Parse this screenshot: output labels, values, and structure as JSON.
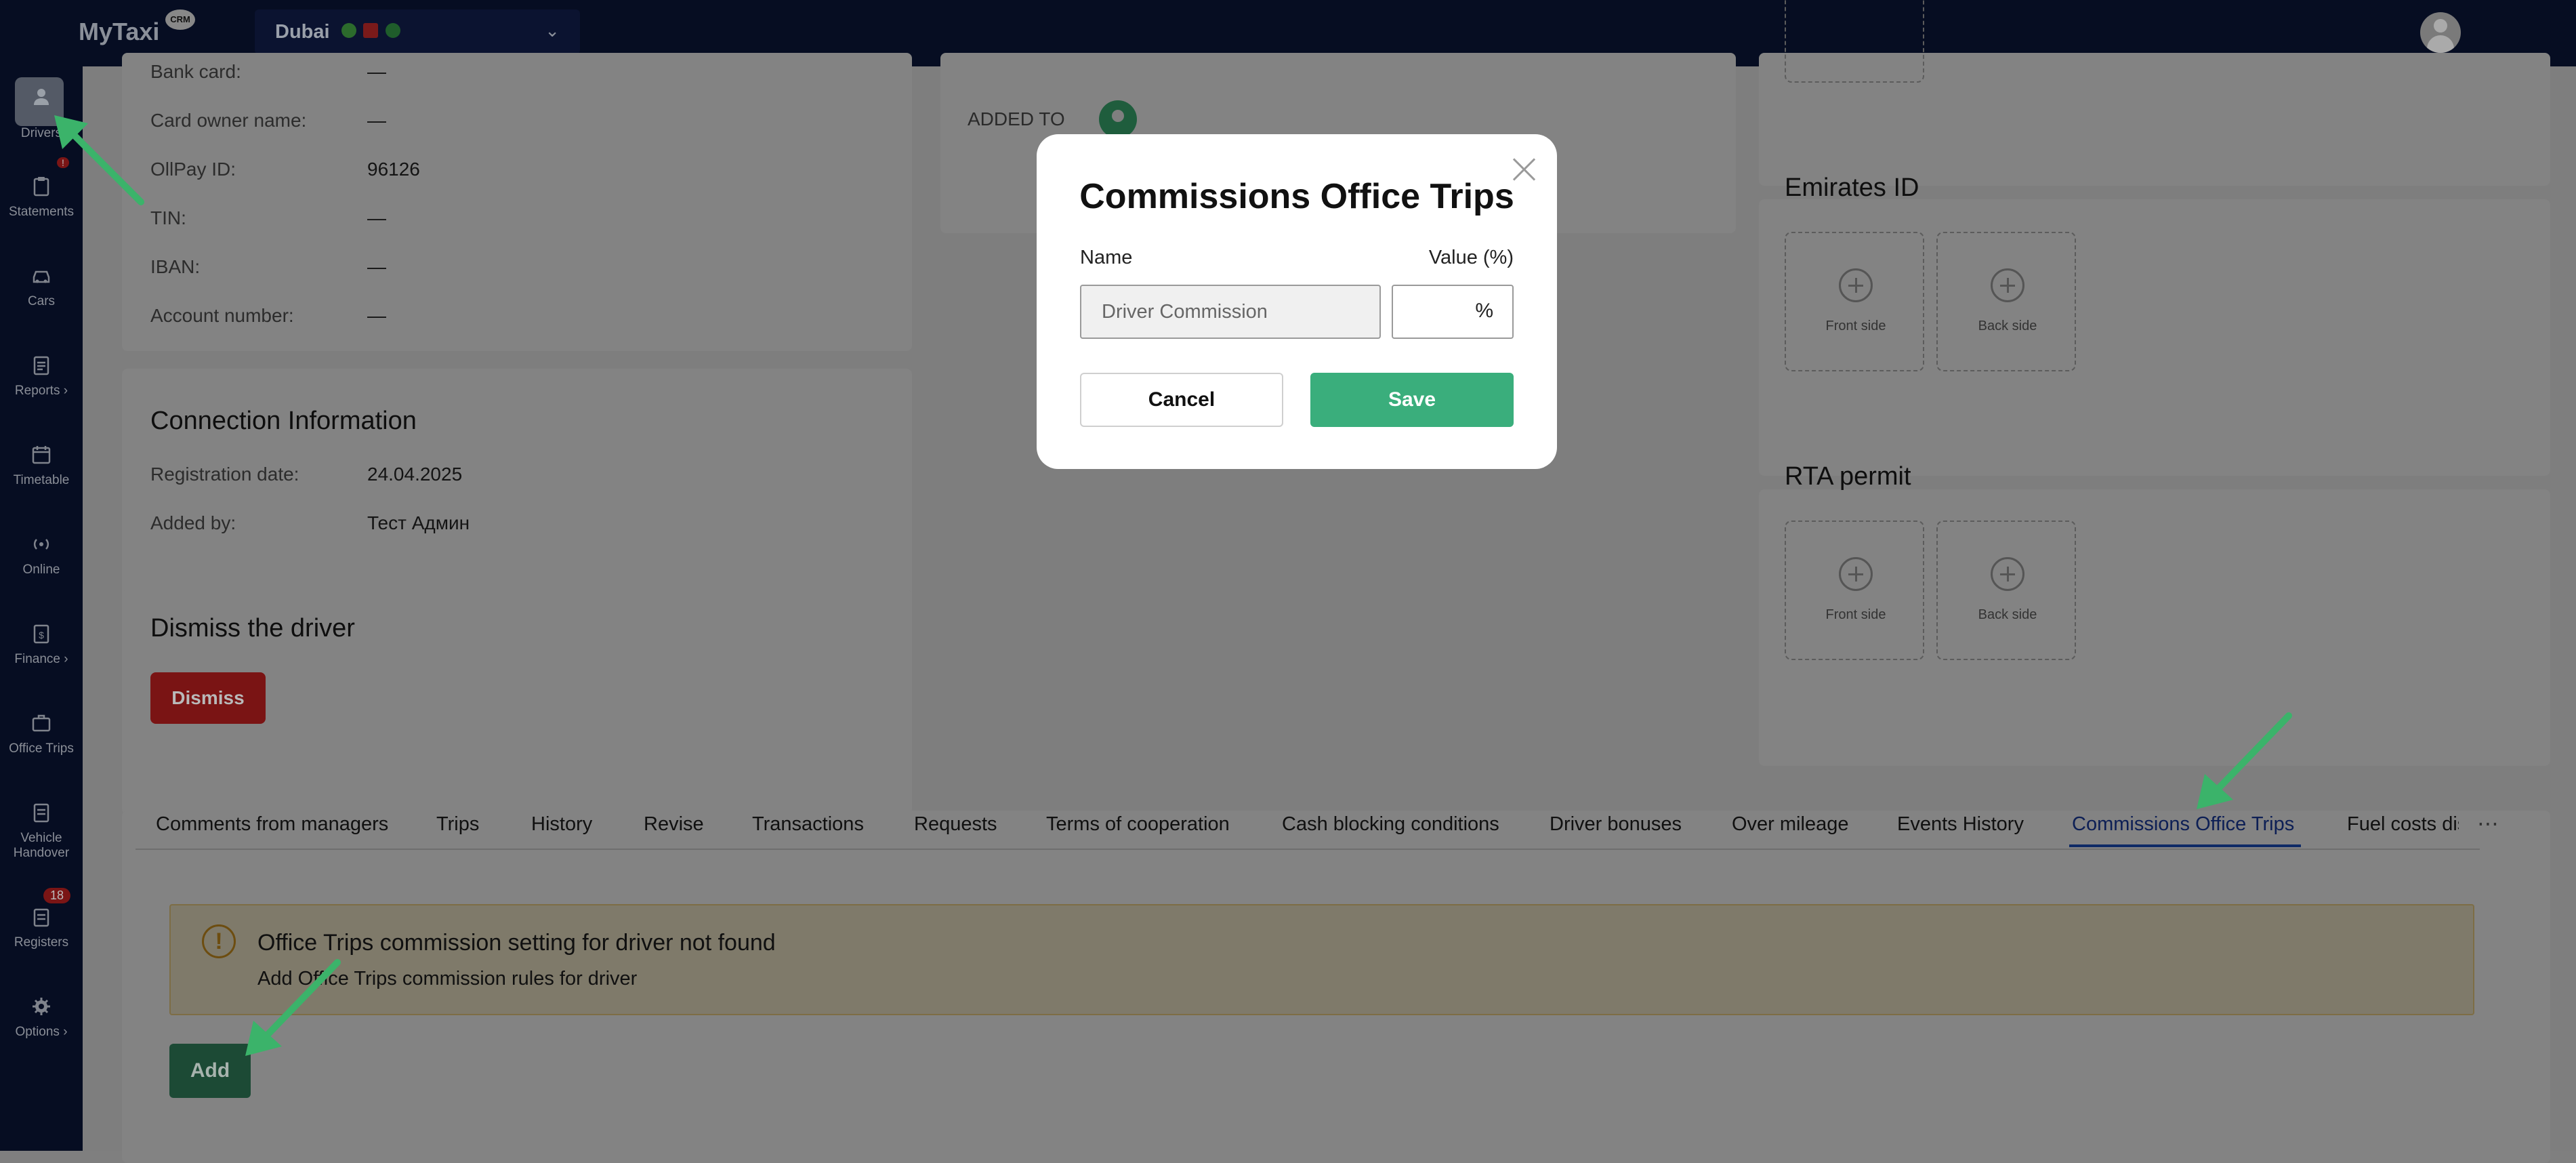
{
  "app": {
    "logo": "MyTaxi",
    "logo_badge": "CRM"
  },
  "header": {
    "city": "Dubai"
  },
  "sidebar": {
    "items": [
      {
        "label": "Drivers",
        "icon": "user-icon"
      },
      {
        "label": "Statements",
        "icon": "clipboard-icon",
        "badge": "!"
      },
      {
        "label": "Cars",
        "icon": "car-icon"
      },
      {
        "label": "Reports",
        "icon": "report-icon",
        "chevron": "›"
      },
      {
        "label": "Timetable",
        "icon": "calendar-icon"
      },
      {
        "label": "Online",
        "icon": "broadcast-icon"
      },
      {
        "label": "Finance",
        "icon": "finance-icon",
        "chevron": "›"
      },
      {
        "label": "Office Trips",
        "icon": "briefcase-icon"
      },
      {
        "label": "Vehicle Handover",
        "icon": "handover-icon"
      },
      {
        "label": "Registers",
        "icon": "register-icon",
        "badge": "18"
      },
      {
        "label": "Options",
        "icon": "gear-icon",
        "chevron": "›"
      }
    ]
  },
  "bank": {
    "rows": [
      {
        "label": "Bank card:",
        "value": "—"
      },
      {
        "label": "Card owner name:",
        "value": "—"
      },
      {
        "label": "OllPay ID:",
        "value": "96126"
      },
      {
        "label": "TIN:",
        "value": "—"
      },
      {
        "label": "IBAN:",
        "value": "—"
      },
      {
        "label": "Account number:",
        "value": "—"
      }
    ]
  },
  "connection": {
    "title": "Connection Information",
    "rows": [
      {
        "label": "Registration date:",
        "value": "24.04.2025"
      },
      {
        "label": "Added by:",
        "value": "Тест Админ"
      }
    ]
  },
  "dismiss": {
    "title": "Dismiss the driver",
    "button": "Dismiss"
  },
  "middle": {
    "added_to": "ADDED TO"
  },
  "documents": {
    "emirates": {
      "title": "Emirates ID",
      "front": "Front side",
      "back": "Back side"
    },
    "rta": {
      "title": "RTA permit",
      "front": "Front side",
      "back": "Back side"
    }
  },
  "tabs": [
    "Comments from managers",
    "Trips",
    "History",
    "Revise",
    "Transactions",
    "Requests",
    "Terms of cooperation",
    "Cash blocking conditions",
    "Driver bonuses",
    "Over mileage",
    "Events History",
    "Commissions Office Trips",
    "Fuel costs dis"
  ],
  "active_tab": "Commissions Office Trips",
  "tabs_more": "⋯",
  "alert": {
    "title": "Office Trips commission setting for driver not found",
    "subtitle": "Add Office Trips commission rules for driver"
  },
  "add_button": "Add",
  "modal": {
    "title": "Commissions Office Trips",
    "name_label": "Name",
    "value_label": "Value (%)",
    "name_value": "Driver Commission",
    "value_suffix": "%",
    "cancel": "Cancel",
    "save": "Save"
  },
  "colors": {
    "accent": "#3aae7c",
    "danger": "#c62828",
    "nav_bg": "#0b1533",
    "arrow": "#3bb36a"
  }
}
